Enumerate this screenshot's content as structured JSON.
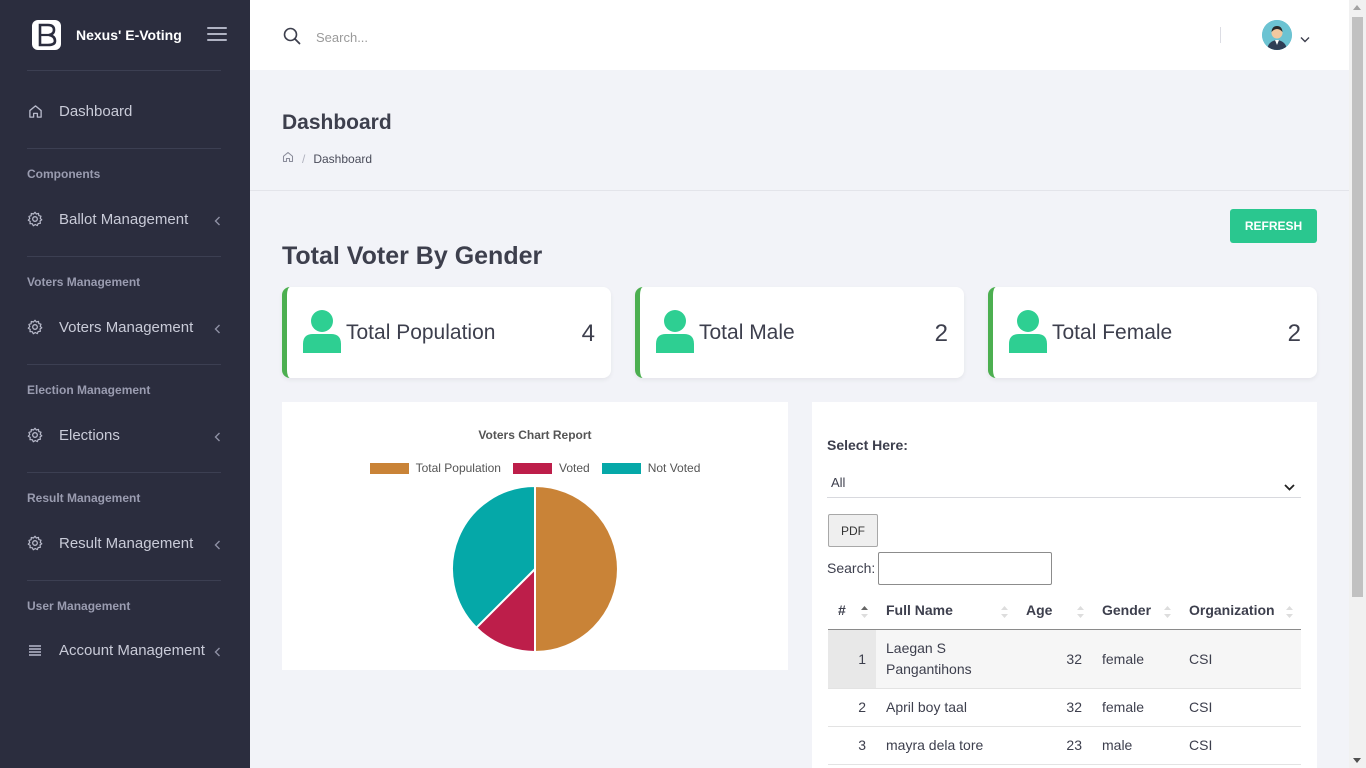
{
  "brand": {
    "name": "Nexus' E-Voting"
  },
  "sidebar": {
    "dashboard": "Dashboard",
    "sections": [
      {
        "label": "Components",
        "item": "Ballot Management"
      },
      {
        "label": "Voters Management",
        "item": "Voters Management"
      },
      {
        "label": "Election Management",
        "item": "Elections"
      },
      {
        "label": "Result Management",
        "item": "Result Management"
      },
      {
        "label": "User Management",
        "item": "Account Management"
      }
    ]
  },
  "header": {
    "search_placeholder": "Search..."
  },
  "page": {
    "title": "Dashboard",
    "breadcrumb": "Dashboard",
    "refresh_label": "REFRESH",
    "section_title": "Total Voter By Gender"
  },
  "stats": [
    {
      "label": "Total Population",
      "value": "4"
    },
    {
      "label": "Total Male",
      "value": "2"
    },
    {
      "label": "Total Female",
      "value": "2"
    }
  ],
  "chart_data": {
    "type": "pie",
    "title": "Voters Chart Report",
    "categories": [
      "Total Population",
      "Voted",
      "Not Voted"
    ],
    "values": [
      4,
      1,
      3
    ],
    "colors": [
      "#c98337",
      "#bd1e4a",
      "#05a8a8"
    ],
    "legend": "top"
  },
  "table_panel": {
    "select_label": "Select Here:",
    "select_value": "All",
    "pdf_label": "PDF",
    "search_label": "Search:",
    "columns": [
      "#",
      "Full Name",
      "Age",
      "Gender",
      "Organization"
    ],
    "rows": [
      {
        "no": "1",
        "name": "Laegan S Pangantihons",
        "age": "32",
        "gender": "female",
        "org": "CSI"
      },
      {
        "no": "2",
        "name": "April boy taal",
        "age": "32",
        "gender": "female",
        "org": "CSI"
      },
      {
        "no": "3",
        "name": "mayra dela tore",
        "age": "23",
        "gender": "male",
        "org": "CSI"
      }
    ]
  },
  "colors": {
    "sidebar_bg": "#2b2d3e",
    "accent_green": "#2ac78f",
    "card_border": "#4caf50",
    "person_icon": "#2ecf92"
  }
}
